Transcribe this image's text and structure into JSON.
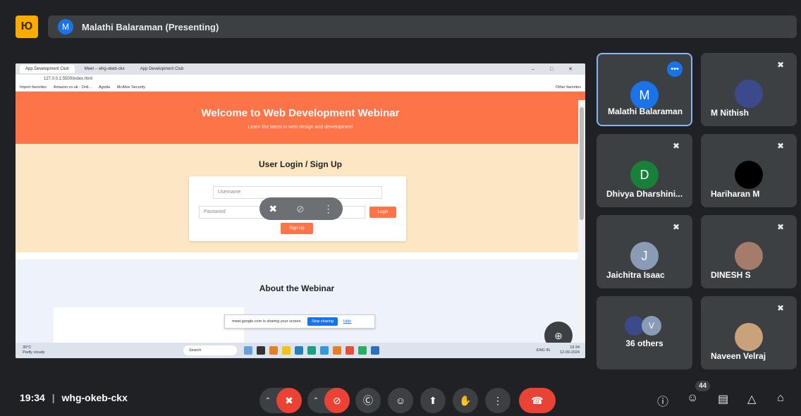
{
  "presenter": {
    "initial": "M",
    "label": "Malathi Balaraman (Presenting)"
  },
  "app_logo": "Ю",
  "browser": {
    "tabs": [
      "App Development Club",
      "Meet – whg-okeb-ckx",
      "App Development Club"
    ],
    "window_controls": "– □ ✕",
    "url": "127.0.0.1:5500/index.html",
    "favorites": [
      "Import favorites",
      "Amazon.co.uk - Onli...",
      "Agoda",
      "McAfee Security"
    ],
    "other_favorites": "Other favorites"
  },
  "webpage": {
    "hero_title": "Welcome to Web Development Webinar",
    "hero_sub": "Learn the latest in web design and development",
    "login_title": "User Login / Sign Up",
    "username_placeholder": "Username",
    "password_placeholder": "Password",
    "login_btn": "Login",
    "signup_btn": "Sign Up",
    "about_title": "About the Webinar"
  },
  "share_notice": {
    "text": "meet.google.com is sharing your screen.",
    "stop": "Stop sharing",
    "hide": "Hide"
  },
  "taskbar": {
    "weather_temp": "30°C",
    "weather_desc": "Partly cloudy",
    "search": "Search",
    "lang": "ENG IN",
    "time": "19:34",
    "date": "12-09-2024"
  },
  "participants": [
    {
      "name": "Malathi Balaraman",
      "initial": "M",
      "color": "#1a73e8",
      "muted": false,
      "active": true
    },
    {
      "name": "M Nithish",
      "initial": "",
      "color": "#3a4a8a",
      "muted": true,
      "active": false
    },
    {
      "name": "Dhivya Dharshini...",
      "initial": "D",
      "color": "#188038",
      "muted": true,
      "active": false
    },
    {
      "name": "Hariharan M",
      "initial": "",
      "color": "#000000",
      "muted": true,
      "active": false
    },
    {
      "name": "Jaichitra Isaac",
      "initial": "J",
      "color": "#8a9bb5",
      "muted": true,
      "active": false
    },
    {
      "name": "DINESH S",
      "initial": "",
      "color": "#a57b6b",
      "muted": true,
      "active": false
    },
    {
      "name": "36 others",
      "initial": "V",
      "color": "#8a9bb5",
      "muted": false,
      "active": false
    },
    {
      "name": "Naveen Velraj",
      "initial": "",
      "color": "#c9a27a",
      "muted": true,
      "active": false
    }
  ],
  "bottom": {
    "time": "19:34",
    "meeting_code": "whg-okeb-ckx",
    "people_count": "44"
  },
  "icons": {
    "mic_off": "✖",
    "chevron_up": "⌃",
    "camera_off": "⊘",
    "captions": "Ⓒ",
    "emoji": "☺",
    "present": "⬆",
    "hand": "✋",
    "more": "⋮",
    "end_call": "☎",
    "info": "ⓘ",
    "people": "☺",
    "chat": "▤",
    "activities": "△",
    "lock": "⌂",
    "zoom": "⊕",
    "tile_more": "•••",
    "mute": "✖"
  }
}
